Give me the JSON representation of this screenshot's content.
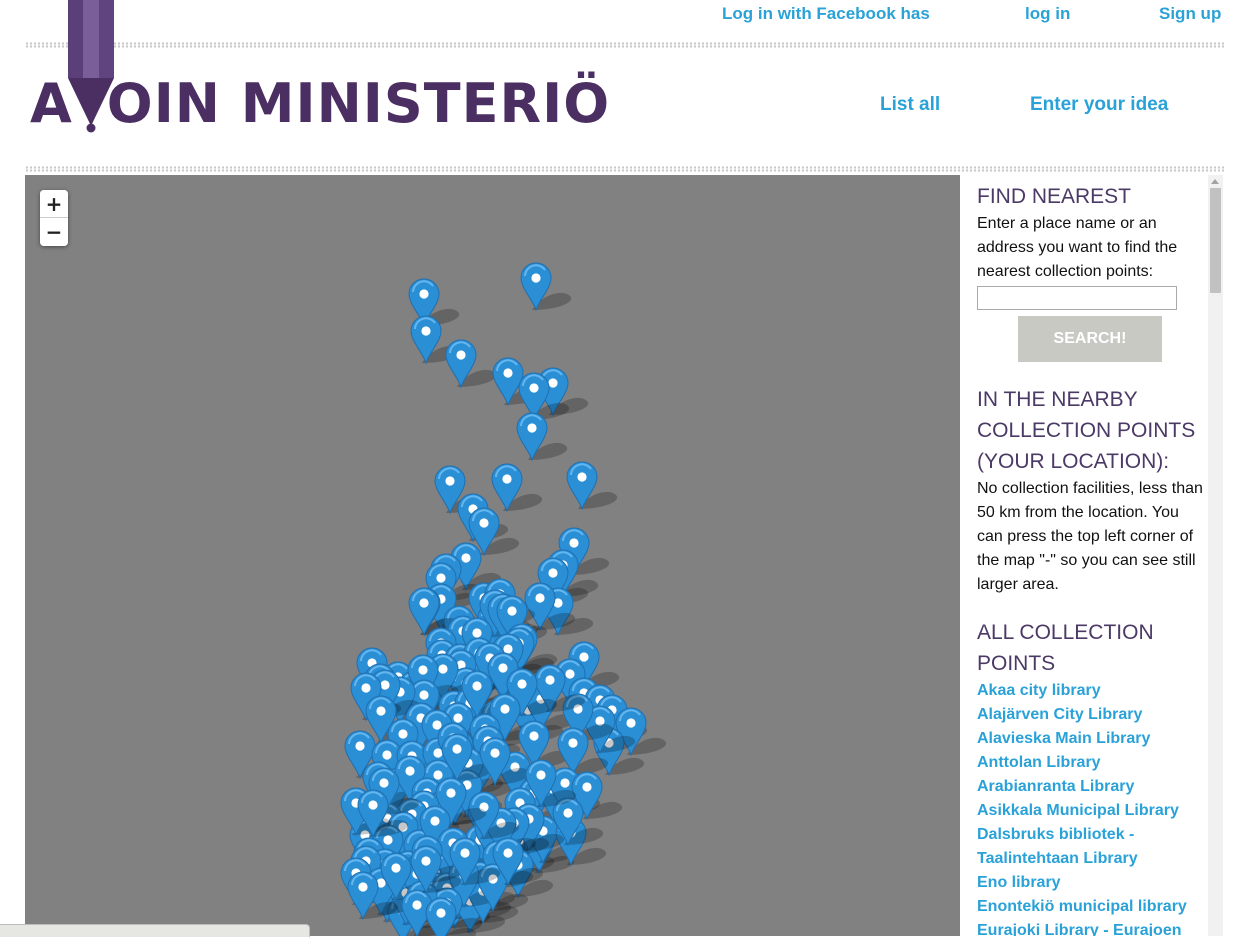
{
  "top_nav": {
    "facebook_login": "Log in with Facebook has",
    "login": "log in",
    "signup": "Sign up"
  },
  "logo": {
    "text_left": "A",
    "text_right": "OIN MINISTERIÖ"
  },
  "main_nav": {
    "list_all": "List all",
    "enter_idea": "Enter your idea"
  },
  "map": {
    "zoom_in": "+",
    "zoom_out": "−"
  },
  "sidebar": {
    "find_nearest": {
      "heading": "FIND NEAREST",
      "instructions": "Enter a place name or an address you want to find the nearest collection points:",
      "input_value": "",
      "button": "SEARCH!"
    },
    "nearby": {
      "heading": "IN THE NEARBY COLLECTION POINTS (YOUR LOCATION):",
      "message": "No collection facilities, less than 50 km from the location. You can press the top left corner of the map \"-\" so you can see still larger area."
    },
    "all_points": {
      "heading": "ALL COLLECTION POINTS",
      "libraries": [
        "Akaa city library",
        "Alajärven City Library",
        "Alavieska Main Library",
        "Anttolan Library",
        "Arabianranta Library",
        "Asikkala Municipal Library",
        "Dalsbruks bibliotek - Taalintehtaan Library",
        "Eno library",
        "Enontekiö municipal library",
        "Eurajoki Library - Eurajoen kirjasto"
      ]
    }
  },
  "colors": {
    "link": "#2aa2d8",
    "logo": "#4b2e62",
    "heading": "#4b3966",
    "map_background": "#818181",
    "marker": "#2b8fd6"
  },
  "icons": {
    "marker": "map-marker-icon",
    "zoom_in": "plus-icon",
    "zoom_out": "minus-icon",
    "pencil": "pencil-icon"
  }
}
